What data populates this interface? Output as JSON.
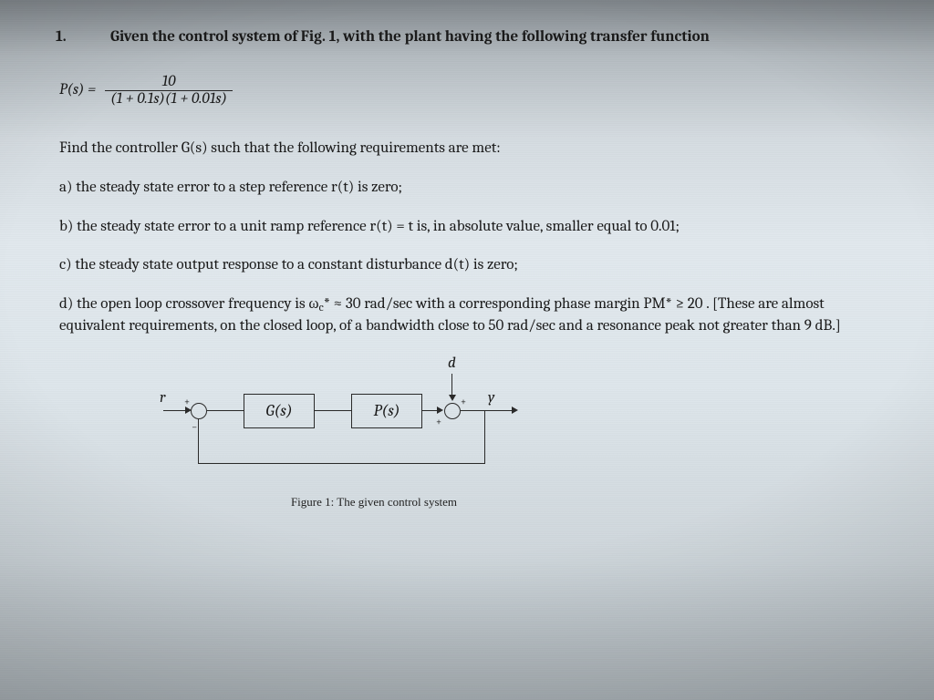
{
  "question": {
    "number": "1.",
    "intro": "Given the control system of Fig. 1, with the plant having the following transfer function"
  },
  "formula": {
    "lhs": "P(s) =",
    "numerator": "10",
    "denominator": "(1 + 0.1s)(1 + 0.01s)"
  },
  "lead": "Find the controller G(s) such that the following requirements are met:",
  "items": {
    "a": "a) the steady state error to a step reference r(t) is zero;",
    "b": "b) the steady state error to a unit ramp reference r(t) = t  is, in absolute value, smaller equal to 0.01;",
    "c": "c) the steady state output response to a constant disturbance d(t) is zero;",
    "d1": "d) the open loop crossover frequency is ω",
    "d_sub": "c",
    "d_star": "*",
    "d2": " ≈ 30 rad/sec with a corresponding phase margin PM* ≥ 20 . [These are almost equivalent requirements, on the closed loop, of a bandwidth close to 50 rad/sec and a resonance peak not greater than 9 dB.]"
  },
  "figure": {
    "r": "r",
    "d": "d",
    "y": "y",
    "G": "G(s)",
    "P": "P(s)",
    "plus": "+",
    "minus": "−",
    "caption": "Figure 1: The given control system"
  }
}
